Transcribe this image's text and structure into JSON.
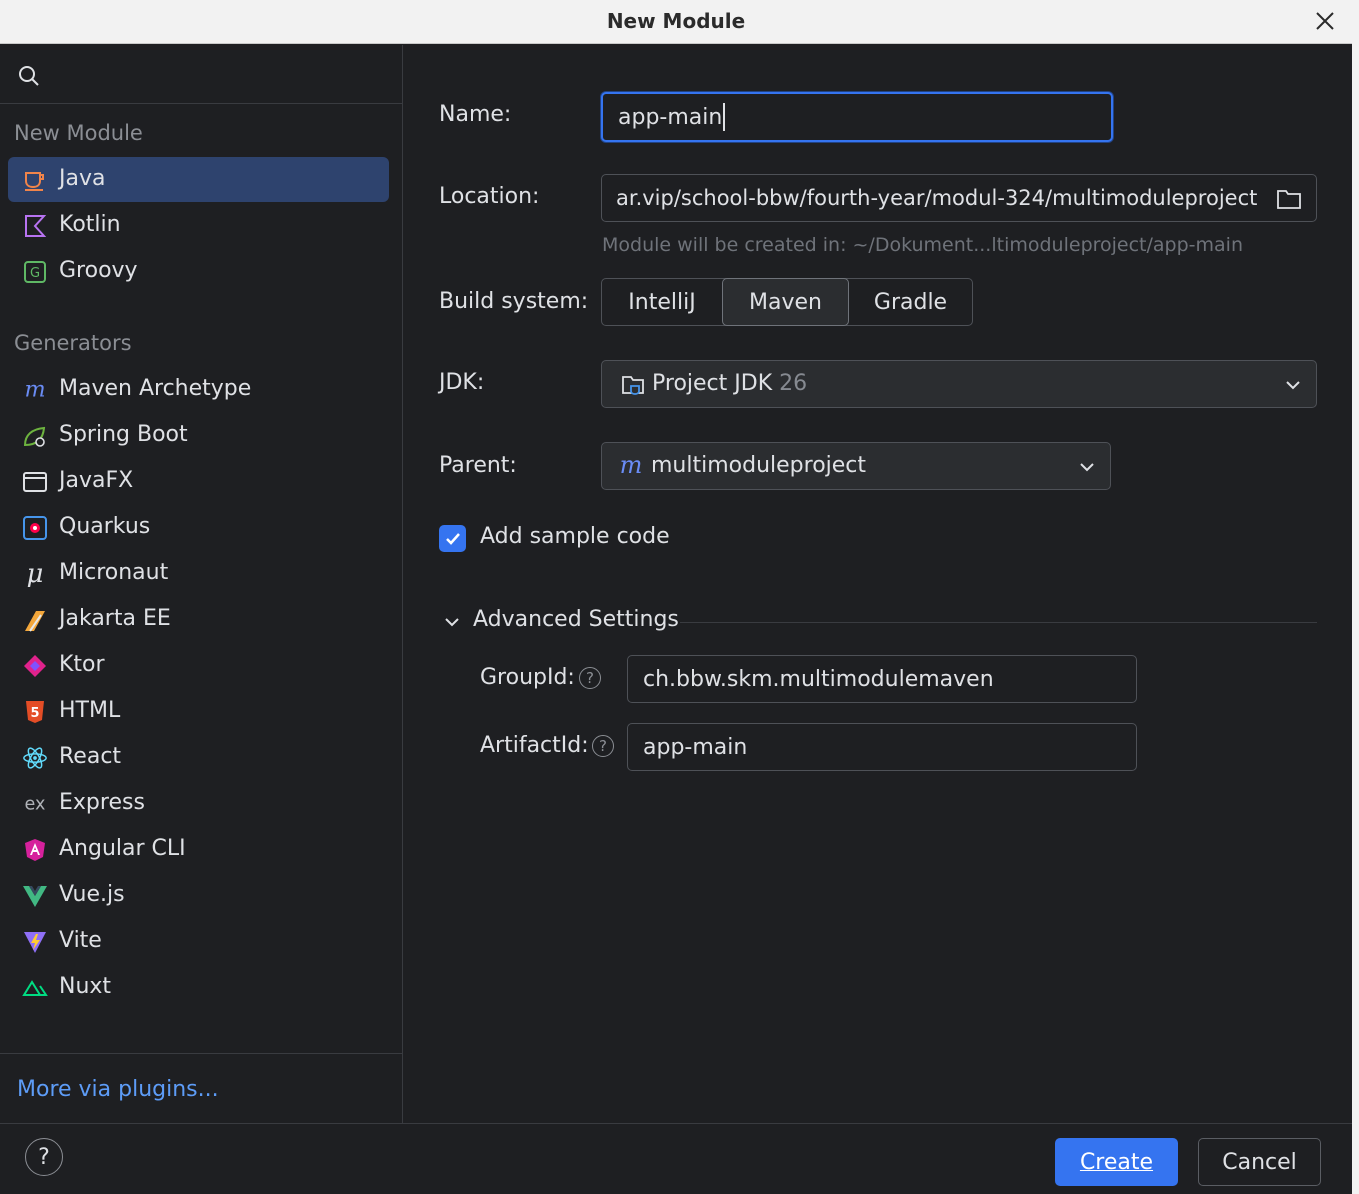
{
  "window": {
    "title": "New Module"
  },
  "sidebar": {
    "search_icon": "search-icon",
    "sections": [
      {
        "title": "New Module",
        "items": [
          {
            "label": "Java",
            "icon": "java-icon",
            "selected": true
          },
          {
            "label": "Kotlin",
            "icon": "kotlin-icon"
          },
          {
            "label": "Groovy",
            "icon": "groovy-icon"
          }
        ]
      },
      {
        "title": "Generators",
        "items": [
          {
            "label": "Maven Archetype",
            "icon": "maven-icon"
          },
          {
            "label": "Spring Boot",
            "icon": "spring-boot-icon"
          },
          {
            "label": "JavaFX",
            "icon": "javafx-icon"
          },
          {
            "label": "Quarkus",
            "icon": "quarkus-icon"
          },
          {
            "label": "Micronaut",
            "icon": "micronaut-icon"
          },
          {
            "label": "Jakarta EE",
            "icon": "jakarta-ee-icon"
          },
          {
            "label": "Ktor",
            "icon": "ktor-icon"
          },
          {
            "label": "HTML",
            "icon": "html5-icon"
          },
          {
            "label": "React",
            "icon": "react-icon"
          },
          {
            "label": "Express",
            "icon": "express-icon"
          },
          {
            "label": "Angular CLI",
            "icon": "angular-icon"
          },
          {
            "label": "Vue.js",
            "icon": "vue-icon"
          },
          {
            "label": "Vite",
            "icon": "vite-icon"
          },
          {
            "label": "Nuxt",
            "icon": "nuxt-icon"
          }
        ]
      }
    ],
    "footer_link": "More via plugins..."
  },
  "form": {
    "name": {
      "label": "Name:",
      "value": "app-main"
    },
    "location": {
      "label": "Location:",
      "value": "ar.vip/school-bbw/fourth-year/modul-324/multimoduleproject",
      "hint": "Module will be created in: ~/Dokument...ltimoduleproject/app-main"
    },
    "build_system": {
      "label": "Build system:",
      "options": [
        "IntelliJ",
        "Maven",
        "Gradle"
      ],
      "selected": "Maven"
    },
    "jdk": {
      "label": "JDK:",
      "value": "Project JDK",
      "version": "26"
    },
    "parent": {
      "label": "Parent:",
      "value": "multimoduleproject"
    },
    "sample_code": {
      "label": "Add sample code",
      "checked": true
    },
    "advanced": {
      "title": "Advanced Settings",
      "group_id": {
        "label": "GroupId:",
        "value": "ch.bbw.skm.multimodulemaven"
      },
      "artifact_id": {
        "label": "ArtifactId:",
        "value": "app-main"
      }
    }
  },
  "buttons": {
    "help": "?",
    "create": "Create",
    "cancel": "Cancel"
  },
  "colors": {
    "accent": "#3574f0",
    "selection": "#2e436e",
    "background": "#1e1f22",
    "link": "#5d9cf7"
  }
}
